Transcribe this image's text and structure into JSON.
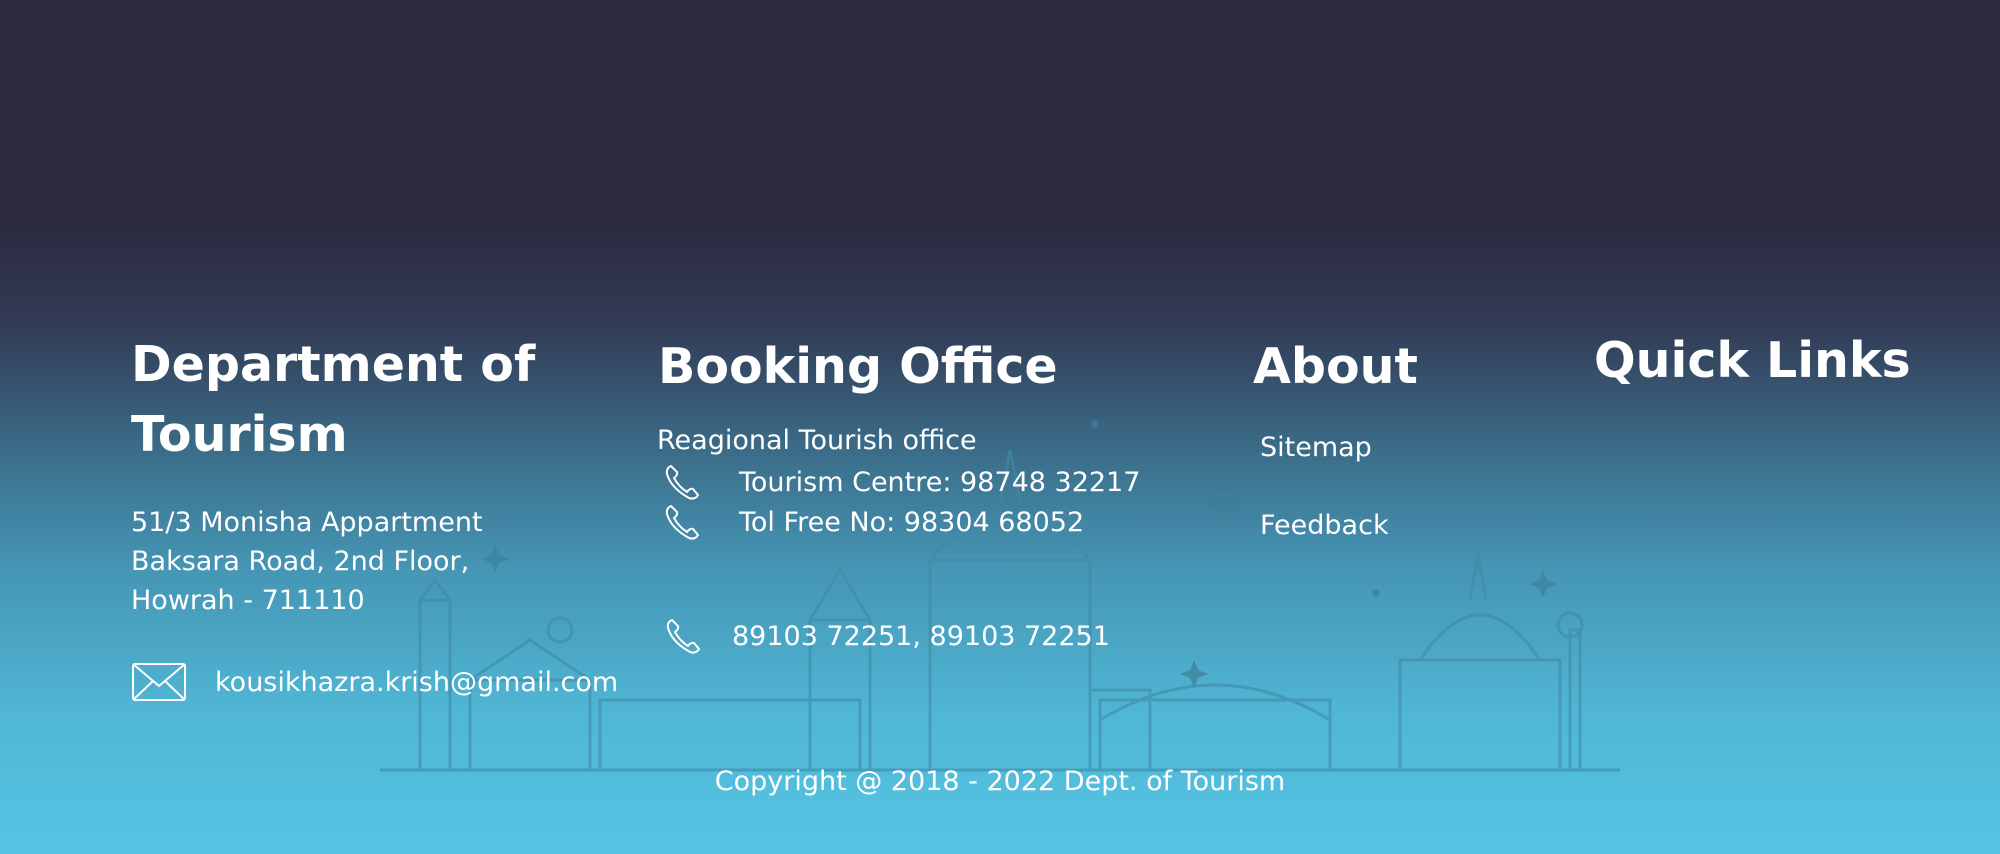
{
  "department": {
    "title": "Department of Tourism",
    "address_line1": "51/3 Monisha Appartment",
    "address_line2": "Baksara Road, 2nd Floor,",
    "address_line3": "Howrah - 711110",
    "email": "kousikhazra.krish@gmail.com",
    "email_icon": "mail-icon"
  },
  "booking": {
    "title": "Booking Office",
    "subtitle": "Reagional Tourish office",
    "phones": [
      {
        "icon": "phone-icon",
        "text": "Tourism Centre: 98748  32217"
      },
      {
        "icon": "phone-icon",
        "text": "Tol Free No: 98304  68052"
      },
      {
        "icon": "phone-icon",
        "text": "89103  72251, 89103  72251"
      }
    ]
  },
  "about": {
    "title": "About",
    "links": [
      "Sitemap",
      "Feedback"
    ]
  },
  "quick_links": {
    "title": "Quick Links"
  },
  "footer": {
    "copyright": "Copyright  @  2018  -  2022  Dept. of Tourism"
  },
  "colors": {
    "bg_top": "#2b283f",
    "bg_bottom": "#55c4e3",
    "text": "#ffffff"
  }
}
